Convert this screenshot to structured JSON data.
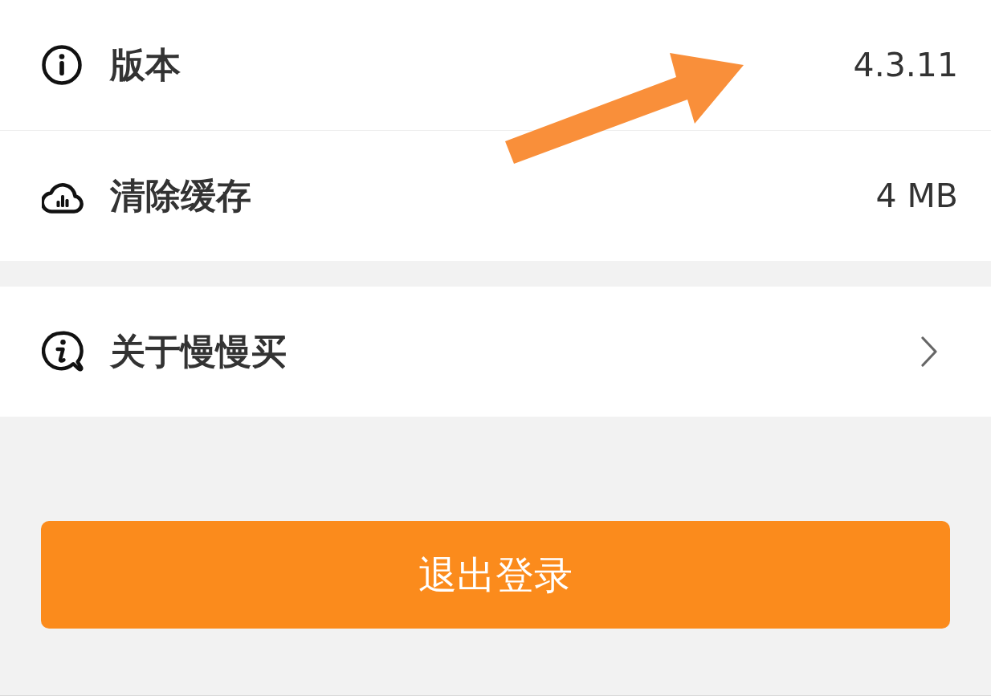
{
  "groups": [
    {
      "rows": [
        {
          "kind": "value",
          "label": "版本",
          "value": "4.3.11"
        },
        {
          "kind": "value",
          "label": "清除缓存",
          "value": "4 MB"
        }
      ]
    },
    {
      "rows": [
        {
          "kind": "link",
          "label": "关于慢慢买"
        }
      ]
    }
  ],
  "logout_button": {
    "label": "退出登录"
  }
}
